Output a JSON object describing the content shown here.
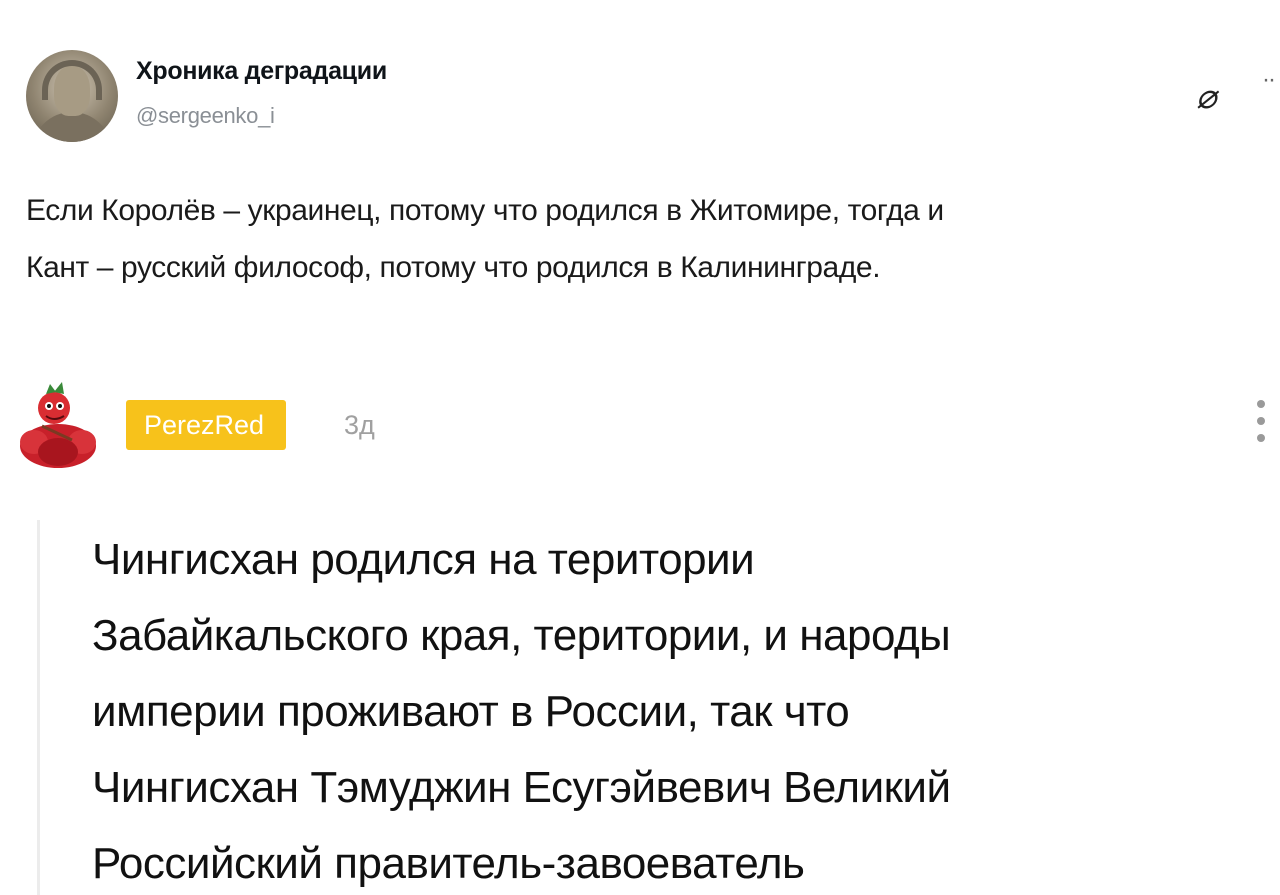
{
  "tweet": {
    "display_name": "Хроника деградации",
    "handle": "@sergeenko_i",
    "text_line1": "Если Королёв – украинец, потому что родился в Житомире, тогда и",
    "text_line2": "Кант – русский философ, потому что родился в Калининграде.",
    "icon_glyph": "⌀",
    "more_glyph": "··"
  },
  "comment": {
    "username": "PerezRed",
    "age": "3д",
    "lines": [
      "Чингисхан родился на територии",
      "Забайкальского края, територии, и народы",
      "империи проживают в России, так что",
      "Чингисхан Тэмуджин Есугэйвевич Великий",
      "Российский правитель-завоеватель"
    ]
  },
  "colors": {
    "badge": "#f7c21b",
    "avatar_red": "#c8202a",
    "muted_text": "#a0a0a0"
  },
  "icons": {
    "tweet_icon": "null-set-icon",
    "tweet_more": "more-horizontal-icon",
    "comment_menu": "more-vertical-icon",
    "comment_avatar": "red-mascot-avatar"
  }
}
